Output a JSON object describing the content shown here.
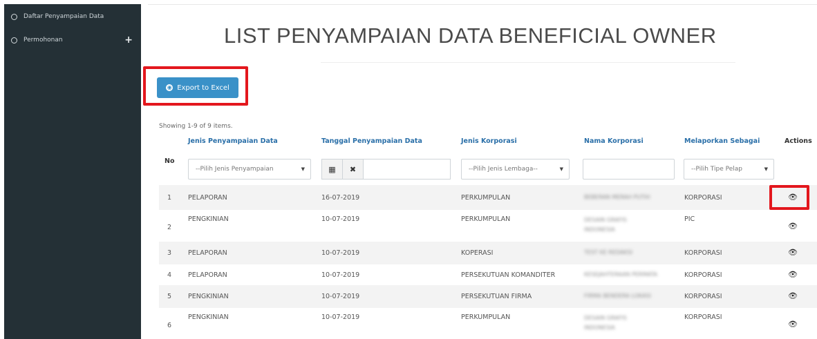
{
  "sidebar": {
    "items": [
      {
        "label": "Daftar Penyampaian Data",
        "icon": "circle-icon"
      },
      {
        "label": "Permohonan",
        "icon": "circle-icon",
        "expand": "+"
      }
    ]
  },
  "page": {
    "title": "LIST PENYAMPAIAN DATA BENEFICIAL OWNER",
    "export_label": "Export to Excel",
    "summary": "Showing 1-9 of 9 items."
  },
  "table": {
    "columns": [
      "No",
      "Jenis Penyampaian Data",
      "Tanggal Penyampaian Data",
      "Jenis Korporasi",
      "Nama Korporasi",
      "Melaporkan Sebagai",
      "Actions"
    ],
    "filters": {
      "jenis_penyampaian": "--Pilih Jenis Penyampaian",
      "jenis_korporasi": "--Pilih Jenis Lembaga--",
      "melaporkan": "--Pilih Tipe Pelap"
    },
    "rows": [
      {
        "no": "1",
        "jenis": "PELAPORAN",
        "tanggal": "16-07-2019",
        "korporasi": "PERKUMPULAN",
        "nama": "BEBERAN MERAH PUTIH",
        "sebagai": "KORPORASI"
      },
      {
        "no": "2",
        "jenis": "PENGKINIAN",
        "tanggal": "10-07-2019",
        "korporasi": "PERKUMPULAN",
        "nama": "DESAIN GRAFIS INDONESIA",
        "sebagai": "PIC"
      },
      {
        "no": "3",
        "jenis": "PELAPORAN",
        "tanggal": "10-07-2019",
        "korporasi": "KOPERASI",
        "nama": "TEST KE REDAKSI",
        "sebagai": "KORPORASI"
      },
      {
        "no": "4",
        "jenis": "PELAPORAN",
        "tanggal": "10-07-2019",
        "korporasi": "PERSEKUTUAN KOMANDITER",
        "nama": "KESEJAHTERAAN PERMATA",
        "sebagai": "KORPORASI"
      },
      {
        "no": "5",
        "jenis": "PENGKINIAN",
        "tanggal": "10-07-2019",
        "korporasi": "PERSEKUTUAN FIRMA",
        "nama": "FIRMA BENDERA LOKASI",
        "sebagai": "KORPORASI"
      },
      {
        "no": "6",
        "jenis": "PENGKINIAN",
        "tanggal": "10-07-2019",
        "korporasi": "PERKUMPULAN",
        "nama": "DESAIN GRAFIS INDONESIA",
        "sebagai": "KORPORASI"
      }
    ]
  },
  "colors": {
    "sidebar_bg": "#243036",
    "accent": "#3a91c8",
    "highlight": "#e3171d",
    "link": "#2a6fa8"
  }
}
